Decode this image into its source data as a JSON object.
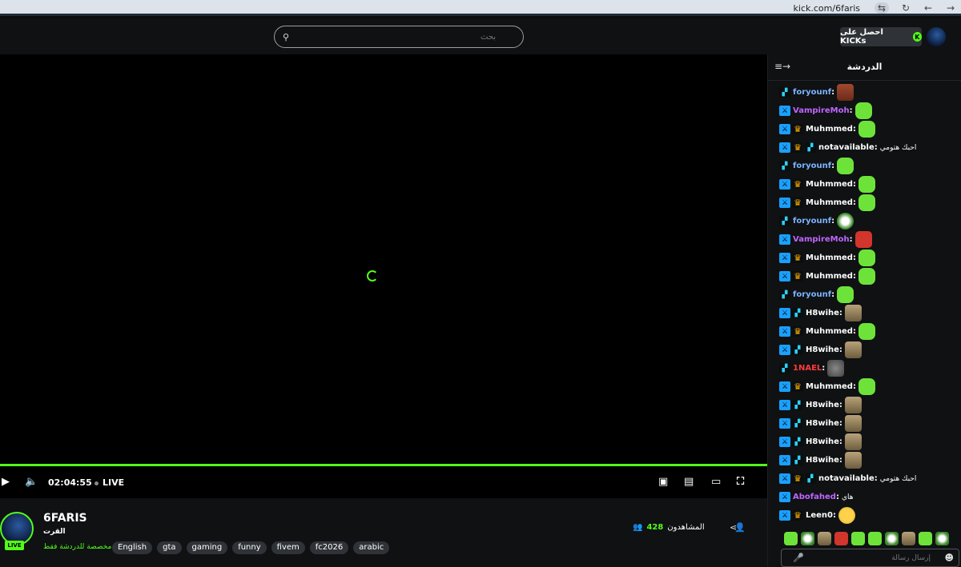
{
  "browser": {
    "url": "kick.com/6faris"
  },
  "nav": {
    "search_placeholder": "بحث",
    "kicks_label": "احصل على KICKs",
    "kicks_logo": "K"
  },
  "player": {
    "time": "02:04:55",
    "live_label": "LIVE"
  },
  "channel": {
    "name": "6FARIS",
    "category": "القرت",
    "chat_only": "مخصصة للدردشة فقط",
    "live_badge": "LIVE",
    "tags": [
      "English",
      "gta",
      "gaming",
      "funny",
      "fivem",
      "fc2026",
      "arabic"
    ],
    "viewers_label": "المشاهدون",
    "viewers_count": "428"
  },
  "chat": {
    "title": "الدردشة",
    "input_placeholder": "إرسال رسالة",
    "messages": [
      {
        "badges": [
          "sub"
        ],
        "user": "foryounf",
        "color": "#7cb3ff",
        "text": "",
        "emote": "face"
      },
      {
        "badges": [
          "mod"
        ],
        "user": "VampireMoh",
        "color": "#c065ff",
        "text": "",
        "emote": "green"
      },
      {
        "badges": [
          "mod",
          "crown"
        ],
        "user": "Muhmmed",
        "color": "#ffffff",
        "text": "",
        "emote": "green"
      },
      {
        "badges": [
          "mod",
          "crown",
          "sub"
        ],
        "user": "notavailable",
        "color": "#ffffff",
        "text": "احبك هتومي",
        "emote": ""
      },
      {
        "badges": [
          "sub"
        ],
        "user": "foryounf",
        "color": "#7cb3ff",
        "text": "",
        "emote": "green"
      },
      {
        "badges": [
          "mod",
          "crown"
        ],
        "user": "Muhmmed",
        "color": "#ffffff",
        "text": "",
        "emote": "green"
      },
      {
        "badges": [
          "mod",
          "crown"
        ],
        "user": "Muhmmed",
        "color": "#ffffff",
        "text": "",
        "emote": "green"
      },
      {
        "badges": [
          "sub"
        ],
        "user": "foryounf",
        "color": "#7cb3ff",
        "text": "",
        "emote": "wave"
      },
      {
        "badges": [
          "mod"
        ],
        "user": "VampireMoh",
        "color": "#c065ff",
        "text": "",
        "emote": "red"
      },
      {
        "badges": [
          "mod",
          "crown"
        ],
        "user": "Muhmmed",
        "color": "#ffffff",
        "text": "",
        "emote": "green"
      },
      {
        "badges": [
          "mod",
          "crown"
        ],
        "user": "Muhmmed",
        "color": "#ffffff",
        "text": "",
        "emote": "green"
      },
      {
        "badges": [
          "sub"
        ],
        "user": "foryounf",
        "color": "#7cb3ff",
        "text": "",
        "emote": "green"
      },
      {
        "badges": [
          "mod",
          "sub"
        ],
        "user": "H8wihe",
        "color": "#ffffff",
        "text": "",
        "emote": "photo"
      },
      {
        "badges": [
          "mod",
          "crown"
        ],
        "user": "Muhmmed",
        "color": "#ffffff",
        "text": "",
        "emote": "green"
      },
      {
        "badges": [
          "mod",
          "sub"
        ],
        "user": "H8wihe",
        "color": "#ffffff",
        "text": "",
        "emote": "photo"
      },
      {
        "badges": [
          "sub"
        ],
        "user": "1NAEL",
        "color": "#ff3b3b",
        "text": "",
        "emote": "grey"
      },
      {
        "badges": [
          "mod",
          "crown"
        ],
        "user": "Muhmmed",
        "color": "#ffffff",
        "text": "",
        "emote": "green"
      },
      {
        "badges": [
          "mod",
          "sub"
        ],
        "user": "H8wihe",
        "color": "#ffffff",
        "text": "",
        "emote": "photo"
      },
      {
        "badges": [
          "mod",
          "sub"
        ],
        "user": "H8wihe",
        "color": "#ffffff",
        "text": "",
        "emote": "photo"
      },
      {
        "badges": [
          "mod",
          "sub"
        ],
        "user": "H8wihe",
        "color": "#ffffff",
        "text": "",
        "emote": "photo"
      },
      {
        "badges": [
          "mod",
          "sub"
        ],
        "user": "H8wihe",
        "color": "#ffffff",
        "text": "",
        "emote": "photo"
      },
      {
        "badges": [
          "mod",
          "crown",
          "sub"
        ],
        "user": "notavailable",
        "color": "#ffffff",
        "text": "احبك هتومي",
        "emote": ""
      },
      {
        "badges": [
          "mod"
        ],
        "user": "Abofahed",
        "color": "#c065ff",
        "text": "هاي",
        "emote": ""
      },
      {
        "badges": [
          "mod",
          "crown"
        ],
        "user": "Leen0",
        "color": "#ffffff",
        "text": "",
        "emote": "nerd"
      }
    ],
    "emote_bar": [
      "green",
      "wave",
      "photo",
      "red",
      "green",
      "green",
      "wave",
      "photo",
      "green",
      "wave"
    ]
  },
  "colors": {
    "accent": "#53fc18"
  }
}
